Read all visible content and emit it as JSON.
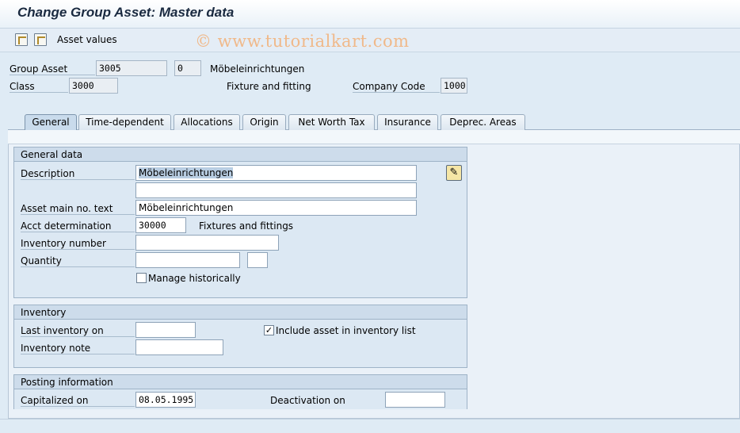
{
  "title": "Change Group Asset:  Master data",
  "toolbar": {
    "asset_values_label": "Asset values"
  },
  "watermark": "© www.tutorialkart.com",
  "header": {
    "group_asset_label": "Group Asset",
    "group_asset_value": "3005",
    "sub_number": "0",
    "group_asset_desc": "Möbeleinrichtungen",
    "class_label": "Class",
    "class_value": "3000",
    "class_desc": "Fixture and fitting",
    "company_code_label": "Company Code",
    "company_code_value": "1000"
  },
  "tabs": [
    {
      "label": "General",
      "active": true
    },
    {
      "label": "Time-dependent"
    },
    {
      "label": "Allocations"
    },
    {
      "label": "Origin"
    },
    {
      "label": "Net Worth Tax"
    },
    {
      "label": "Insurance"
    },
    {
      "label": "Deprec. Areas"
    }
  ],
  "general_data": {
    "title": "General data",
    "description_label": "Description",
    "description_value": "Möbeleinrichtungen",
    "description2_value": "",
    "main_no_text_label": "Asset main no. text",
    "main_no_text_value": "Möbeleinrichtungen",
    "acct_determination_label": "Acct determination",
    "acct_determination_value": "30000",
    "acct_determination_desc": "Fixtures and fittings",
    "inventory_number_label": "Inventory number",
    "inventory_number_value": "",
    "quantity_label": "Quantity",
    "quantity_value": "",
    "unit_value": "",
    "manage_historically_label": "Manage historically",
    "manage_historically_checked": false
  },
  "inventory": {
    "title": "Inventory",
    "last_inventory_label": "Last inventory on",
    "last_inventory_value": "",
    "include_label": "Include asset in inventory list",
    "include_checked": true,
    "inventory_note_label": "Inventory note",
    "inventory_note_value": ""
  },
  "posting": {
    "title": "Posting information",
    "capitalized_label": "Capitalized on",
    "capitalized_value": "08.05.1995",
    "deactivation_label": "Deactivation on",
    "deactivation_value": ""
  },
  "colors": {
    "background": "#dfebf5",
    "group": "#dce8f3",
    "watermark": "#f0b98a"
  },
  "icons": [
    "display-change-icon",
    "other-object-icon",
    "edit-long-text-icon",
    "checkbox-icon"
  ]
}
